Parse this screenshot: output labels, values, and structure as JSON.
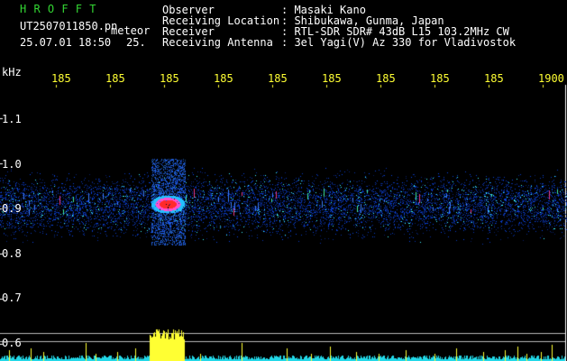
{
  "header": {
    "app_name": "H R O F F T",
    "filename": "UT2507011850.pn",
    "mode": "meteor",
    "datetime": "25.07.01 18:50",
    "count": "25.",
    "fields": [
      {
        "label": "Observer",
        "value": ": Masaki Kano"
      },
      {
        "label": "Receiving Location",
        "value": ": Shibukawa, Gunma, Japan"
      },
      {
        "label": "Receiver",
        "value": ": RTL-SDR SDR# 43dB L15 103.2MHz CW"
      },
      {
        "label": "Receiving Antenna",
        "value": ": 3el Yagi(V) Az 330 for Vladivostok"
      }
    ]
  },
  "axes": {
    "y_unit": "kHz",
    "y_ticks": [
      "1.1",
      "1.0",
      "0.9",
      "0.8",
      "0.7",
      "0.6"
    ],
    "x_ticks": [
      "185",
      "185",
      "185",
      "185",
      "185",
      "185",
      "185",
      "185",
      "185",
      "1900"
    ]
  },
  "colors": {
    "title_green": "#33d633",
    "tick_yellow": "#ffff33",
    "text_white": "#ffffff",
    "noise_cyan": "#22d8e8",
    "echo_red": "#ff2a2a",
    "echo_magenta": "#ff4fd0"
  }
}
